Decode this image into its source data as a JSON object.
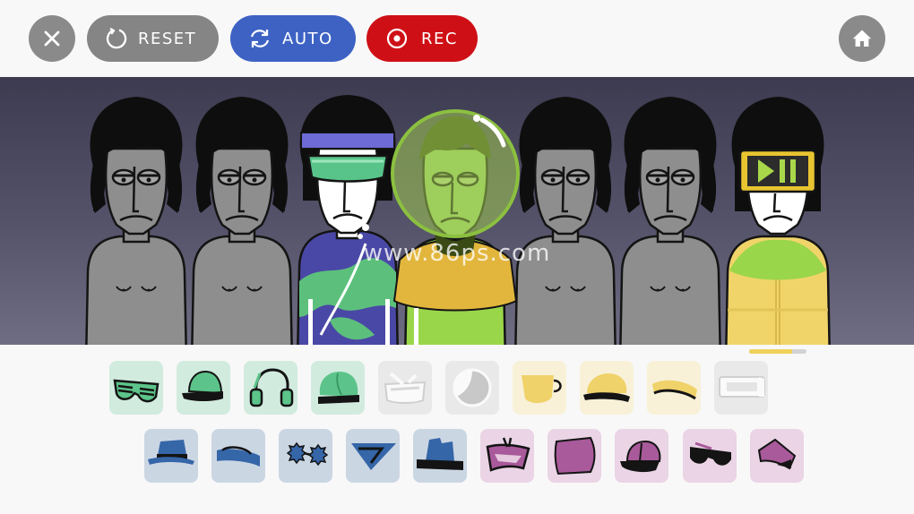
{
  "toolbar": {
    "close_icon": "close-icon",
    "reset_label": "RESET",
    "auto_label": "AUTO",
    "rec_label": "REC",
    "home_icon": "home-icon",
    "colors": {
      "reset": "#858585",
      "auto": "#3d62c4",
      "rec": "#cf0f16",
      "round": "#8a8a8a"
    }
  },
  "stage": {
    "watermark": "www.86ps.com",
    "performers": [
      {
        "slot": 1,
        "state": "idle"
      },
      {
        "slot": 2,
        "state": "idle"
      },
      {
        "slot": 3,
        "state": "active",
        "sound_color": "blue-green"
      },
      {
        "slot": 4,
        "state": "active",
        "sound_color": "yellow-green"
      },
      {
        "slot": 5,
        "state": "idle"
      },
      {
        "slot": 6,
        "state": "idle"
      },
      {
        "slot": 7,
        "state": "active",
        "sound_color": "yellow"
      }
    ],
    "loop_progress": 0.75
  },
  "palette": {
    "row1": [
      {
        "icon": "shutter-shades-icon",
        "group": "green"
      },
      {
        "icon": "green-cap-icon",
        "group": "green"
      },
      {
        "icon": "headphones-icon",
        "group": "green"
      },
      {
        "icon": "green-beanie-icon",
        "group": "green"
      },
      {
        "icon": "white-goggles-icon",
        "group": "used"
      },
      {
        "icon": "bubble-helmet-icon",
        "group": "used"
      },
      {
        "icon": "yellow-mug-icon",
        "group": "yellow"
      },
      {
        "icon": "yellow-helmet-icon",
        "group": "yellow"
      },
      {
        "icon": "yellow-headband-icon",
        "group": "yellow"
      },
      {
        "icon": "led-visor-icon",
        "group": "used"
      }
    ],
    "row2": [
      {
        "icon": "blue-fedora-icon",
        "group": "blue"
      },
      {
        "icon": "blue-headband-icon",
        "group": "blue"
      },
      {
        "icon": "gear-glasses-icon",
        "group": "blue"
      },
      {
        "icon": "blue-visor-icon",
        "group": "blue"
      },
      {
        "icon": "blue-top-hat-icon",
        "group": "blue"
      },
      {
        "icon": "pink-mask-icon",
        "group": "pink"
      },
      {
        "icon": "pink-hood-icon",
        "group": "pink"
      },
      {
        "icon": "pink-cap-icon",
        "group": "pink"
      },
      {
        "icon": "pink-sunglasses-icon",
        "group": "pink"
      },
      {
        "icon": "pink-bucket-hat-icon",
        "group": "pink"
      }
    ],
    "tile_colors": {
      "green": "#d2ebdf",
      "used": "#e9e9e9",
      "yellow": "#f8f1d8",
      "blue": "#cbd6e3",
      "pink": "#ead4e5"
    }
  }
}
